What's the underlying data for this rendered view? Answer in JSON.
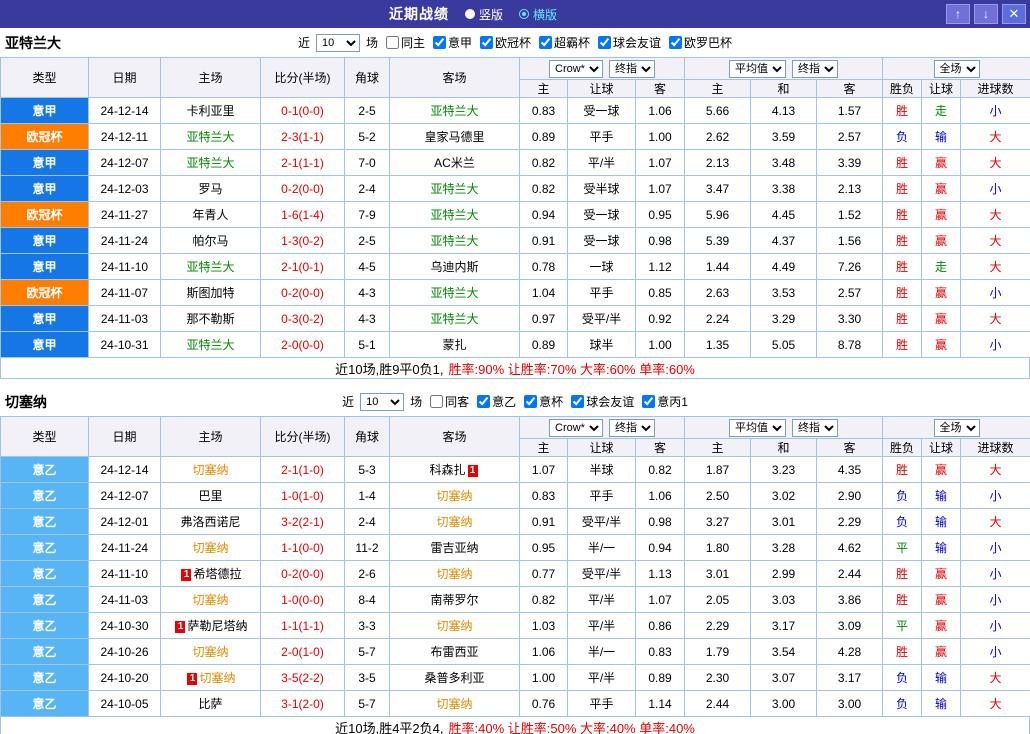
{
  "titlebar": {
    "title": "近期战绩",
    "layout_options": [
      {
        "label": "竖版",
        "selected": false
      },
      {
        "label": "横版",
        "selected": true
      }
    ],
    "up_button": "↑",
    "down_button": "↓",
    "close_button": "✕"
  },
  "filter_words": {
    "near": "近",
    "games": "场"
  },
  "columns": {
    "type": "类型",
    "date": "日期",
    "home": "主场",
    "score": "比分(半场)",
    "corner": "角球",
    "away": "客场",
    "h": "主",
    "handicap": "让球",
    "a": "客",
    "avg_h": "主",
    "avg_d": "和",
    "avg_a": "客",
    "wdl": "胜负",
    "hcp": "让球",
    "goals": "进球数"
  },
  "selects": {
    "bookmaker": "Crow*",
    "final1": "终指",
    "average": "平均值",
    "final2": "终指",
    "scope": "全场"
  },
  "colors": {
    "titlebar": "#3a3a9e",
    "league": {
      "意甲": "#1577e6",
      "欧冠杯": "#ff7e00",
      "意乙": "#58b5f5"
    },
    "result": {
      "胜": "#e60000",
      "平": "#008800",
      "负": "#0000cc",
      "赢": "#e60000",
      "输": "#0000cc",
      "走": "#008800",
      "大": "#e60000",
      "小": "#0000cc"
    },
    "score": "#e60000"
  },
  "sections": [
    {
      "team": "亚特兰大",
      "focus_color": "#008800",
      "near_count": "10",
      "filters": [
        {
          "label": "同主",
          "checked": false
        },
        {
          "label": "意甲",
          "checked": true
        },
        {
          "label": "欧冠杯",
          "checked": true
        },
        {
          "label": "超霸杯",
          "checked": true
        },
        {
          "label": "球会友谊",
          "checked": true
        },
        {
          "label": "欧罗巴杯",
          "checked": true
        }
      ],
      "rows": [
        {
          "league": "意甲",
          "date": "24-12-14",
          "home": "卡利亚里",
          "score": "0-1(0-0)",
          "corner": "2-5",
          "away": "亚特兰大",
          "away_focus": true,
          "h": "0.83",
          "hcp": "受一球",
          "a": "1.06",
          "avg_h": "5.66",
          "avg_d": "4.13",
          "avg_a": "1.57",
          "r1": "胜",
          "r2": "走",
          "r3": "小"
        },
        {
          "league": "欧冠杯",
          "date": "24-12-11",
          "home": "亚特兰大",
          "home_focus": true,
          "score": "2-3(1-1)",
          "corner": "5-2",
          "away": "皇家马德里",
          "h": "0.89",
          "hcp": "平手",
          "a": "1.00",
          "avg_h": "2.62",
          "avg_d": "3.59",
          "avg_a": "2.57",
          "r1": "负",
          "r2": "输",
          "r3": "大"
        },
        {
          "league": "意甲",
          "date": "24-12-07",
          "home": "亚特兰大",
          "home_focus": true,
          "score": "2-1(1-1)",
          "corner": "7-0",
          "away": "AC米兰",
          "h": "0.82",
          "hcp": "平/半",
          "a": "1.07",
          "avg_h": "2.13",
          "avg_d": "3.48",
          "avg_a": "3.39",
          "r1": "胜",
          "r2": "赢",
          "r3": "大"
        },
        {
          "league": "意甲",
          "date": "24-12-03",
          "home": "罗马",
          "score": "0-2(0-0)",
          "corner": "2-4",
          "away": "亚特兰大",
          "away_focus": true,
          "h": "0.82",
          "hcp": "受半球",
          "a": "1.07",
          "avg_h": "3.47",
          "avg_d": "3.38",
          "avg_a": "2.13",
          "r1": "胜",
          "r2": "赢",
          "r3": "小"
        },
        {
          "league": "欧冠杯",
          "date": "24-11-27",
          "home": "年青人",
          "score": "1-6(1-4)",
          "corner": "7-9",
          "away": "亚特兰大",
          "away_focus": true,
          "h": "0.94",
          "hcp": "受一球",
          "a": "0.95",
          "avg_h": "5.96",
          "avg_d": "4.45",
          "avg_a": "1.52",
          "r1": "胜",
          "r2": "赢",
          "r3": "大"
        },
        {
          "league": "意甲",
          "date": "24-11-24",
          "home": "帕尔马",
          "score": "1-3(0-2)",
          "corner": "2-5",
          "away": "亚特兰大",
          "away_focus": true,
          "h": "0.91",
          "hcp": "受一球",
          "a": "0.98",
          "avg_h": "5.39",
          "avg_d": "4.37",
          "avg_a": "1.56",
          "r1": "胜",
          "r2": "赢",
          "r3": "大"
        },
        {
          "league": "意甲",
          "date": "24-11-10",
          "home": "亚特兰大",
          "home_focus": true,
          "score": "2-1(0-1)",
          "corner": "4-5",
          "away": "乌迪内斯",
          "h": "0.78",
          "hcp": "一球",
          "a": "1.12",
          "avg_h": "1.44",
          "avg_d": "4.49",
          "avg_a": "7.26",
          "r1": "胜",
          "r2": "走",
          "r3": "大"
        },
        {
          "league": "欧冠杯",
          "date": "24-11-07",
          "home": "斯图加特",
          "score": "0-2(0-0)",
          "corner": "4-3",
          "away": "亚特兰大",
          "away_focus": true,
          "h": "1.04",
          "hcp": "平手",
          "a": "0.85",
          "avg_h": "2.63",
          "avg_d": "3.53",
          "avg_a": "2.57",
          "r1": "胜",
          "r2": "赢",
          "r3": "小"
        },
        {
          "league": "意甲",
          "date": "24-11-03",
          "home": "那不勒斯",
          "score": "0-3(0-2)",
          "corner": "4-3",
          "away": "亚特兰大",
          "away_focus": true,
          "h": "0.97",
          "hcp": "受平/半",
          "a": "0.92",
          "avg_h": "2.24",
          "avg_d": "3.29",
          "avg_a": "3.30",
          "r1": "胜",
          "r2": "赢",
          "r3": "大"
        },
        {
          "league": "意甲",
          "date": "24-10-31",
          "home": "亚特兰大",
          "home_focus": true,
          "score": "2-0(0-0)",
          "corner": "5-1",
          "away": "蒙扎",
          "h": "0.89",
          "hcp": "球半",
          "a": "1.00",
          "avg_h": "1.35",
          "avg_d": "5.05",
          "avg_a": "8.78",
          "r1": "胜",
          "r2": "赢",
          "r3": "小"
        }
      ],
      "summary_prefix": "近10场,胜9平0负1,",
      "summary_stats": "胜率:90% 让胜率:70% 大率:60% 单率:60%"
    },
    {
      "team": "切塞纳",
      "focus_color": "#e08a00",
      "near_count": "10",
      "filters": [
        {
          "label": "同客",
          "checked": false
        },
        {
          "label": "意乙",
          "checked": true
        },
        {
          "label": "意杯",
          "checked": true
        },
        {
          "label": "球会友谊",
          "checked": true
        },
        {
          "label": "意丙1",
          "checked": true
        }
      ],
      "rows": [
        {
          "league": "意乙",
          "date": "24-12-14",
          "home": "切塞纳",
          "home_focus": true,
          "score": "2-1(1-0)",
          "corner": "5-3",
          "away": "科森扎",
          "away_card": "1",
          "away_card_pos": "after",
          "h": "1.07",
          "hcp": "半球",
          "a": "0.82",
          "avg_h": "1.87",
          "avg_d": "3.23",
          "avg_a": "4.35",
          "r1": "胜",
          "r2": "赢",
          "r3": "大"
        },
        {
          "league": "意乙",
          "date": "24-12-07",
          "home": "巴里",
          "score": "1-0(1-0)",
          "corner": "1-4",
          "away": "切塞纳",
          "away_focus": true,
          "h": "0.83",
          "hcp": "平手",
          "a": "1.06",
          "avg_h": "2.50",
          "avg_d": "3.02",
          "avg_a": "2.90",
          "r1": "负",
          "r2": "输",
          "r3": "小"
        },
        {
          "league": "意乙",
          "date": "24-12-01",
          "home": "弗洛西诺尼",
          "score": "3-2(2-1)",
          "corner": "2-4",
          "away": "切塞纳",
          "away_focus": true,
          "h": "0.91",
          "hcp": "受平/半",
          "a": "0.98",
          "avg_h": "3.27",
          "avg_d": "3.01",
          "avg_a": "2.29",
          "r1": "负",
          "r2": "输",
          "r3": "大"
        },
        {
          "league": "意乙",
          "date": "24-11-24",
          "home": "切塞纳",
          "home_focus": true,
          "score": "1-1(0-0)",
          "corner": "11-2",
          "away": "雷吉亚纳",
          "h": "0.95",
          "hcp": "半/一",
          "a": "0.94",
          "avg_h": "1.80",
          "avg_d": "3.28",
          "avg_a": "4.62",
          "r1": "平",
          "r2": "输",
          "r3": "小"
        },
        {
          "league": "意乙",
          "date": "24-11-10",
          "home": "希塔德拉",
          "home_card": "1",
          "home_card_pos": "before",
          "score": "0-2(0-0)",
          "corner": "2-6",
          "away": "切塞纳",
          "away_focus": true,
          "h": "0.77",
          "hcp": "受平/半",
          "a": "1.13",
          "avg_h": "3.01",
          "avg_d": "2.99",
          "avg_a": "2.44",
          "r1": "胜",
          "r2": "赢",
          "r3": "小"
        },
        {
          "league": "意乙",
          "date": "24-11-03",
          "home": "切塞纳",
          "home_focus": true,
          "score": "1-0(0-0)",
          "corner": "8-4",
          "away": "南蒂罗尔",
          "h": "0.82",
          "hcp": "平/半",
          "a": "1.07",
          "avg_h": "2.05",
          "avg_d": "3.03",
          "avg_a": "3.86",
          "r1": "胜",
          "r2": "赢",
          "r3": "小"
        },
        {
          "league": "意乙",
          "date": "24-10-30",
          "home": "萨勒尼塔纳",
          "home_card": "1",
          "home_card_pos": "before",
          "score": "1-1(1-1)",
          "corner": "3-3",
          "away": "切塞纳",
          "away_focus": true,
          "h": "1.03",
          "hcp": "平/半",
          "a": "0.86",
          "avg_h": "2.29",
          "avg_d": "3.17",
          "avg_a": "3.09",
          "r1": "平",
          "r2": "赢",
          "r3": "小"
        },
        {
          "league": "意乙",
          "date": "24-10-26",
          "home": "切塞纳",
          "home_focus": true,
          "score": "2-0(1-0)",
          "corner": "5-7",
          "away": "布雷西亚",
          "h": "1.06",
          "hcp": "半/一",
          "a": "0.83",
          "avg_h": "1.79",
          "avg_d": "3.54",
          "avg_a": "4.28",
          "r1": "胜",
          "r2": "赢",
          "r3": "小"
        },
        {
          "league": "意乙",
          "date": "24-10-20",
          "home": "切塞纳",
          "home_focus": true,
          "home_card": "1",
          "home_card_pos": "before",
          "score": "3-5(2-2)",
          "corner": "3-5",
          "away": "桑普多利亚",
          "h": "1.00",
          "hcp": "平/半",
          "a": "0.89",
          "avg_h": "2.30",
          "avg_d": "3.07",
          "avg_a": "3.17",
          "r1": "负",
          "r2": "输",
          "r3": "大"
        },
        {
          "league": "意乙",
          "date": "24-10-05",
          "home": "比萨",
          "score": "3-1(2-0)",
          "corner": "5-7",
          "away": "切塞纳",
          "away_focus": true,
          "h": "0.76",
          "hcp": "平手",
          "a": "1.14",
          "avg_h": "2.44",
          "avg_d": "3.00",
          "avg_a": "3.00",
          "r1": "负",
          "r2": "输",
          "r3": "大"
        }
      ],
      "summary_prefix": "近10场,胜4平2负4,",
      "summary_stats": "胜率:40% 让胜率:50% 大率:40% 单率:40%"
    }
  ]
}
